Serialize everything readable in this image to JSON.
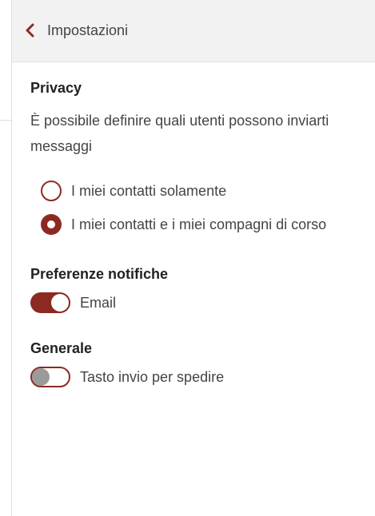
{
  "header": {
    "back_label": "Impostazioni"
  },
  "privacy": {
    "title": "Privacy",
    "description": "È possibile definire quali utenti possono inviarti messaggi",
    "options": [
      {
        "label": "I miei contatti solamente",
        "selected": false
      },
      {
        "label": "I miei contatti e i miei compagni di corso",
        "selected": true
      }
    ]
  },
  "notifications": {
    "title": "Preferenze notifiche",
    "email_label": "Email",
    "email_enabled": true
  },
  "general": {
    "title": "Generale",
    "enter_to_send_label": "Tasto invio per spedire",
    "enter_to_send_enabled": false
  },
  "colors": {
    "accent": "#8c2a22",
    "header_bg": "#f2f2f2"
  },
  "icons": {
    "back": "chevron-left-icon"
  }
}
